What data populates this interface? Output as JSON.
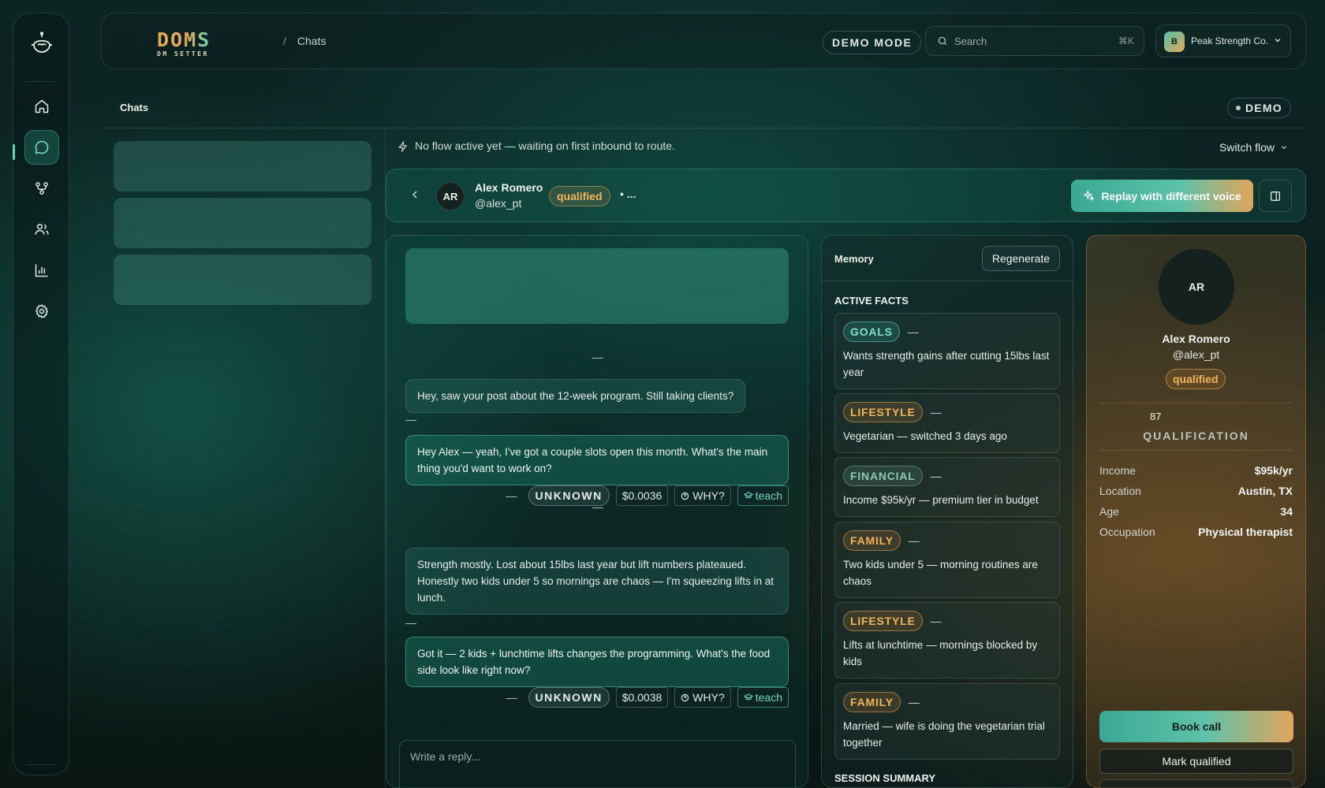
{
  "brand": {
    "name": "DOMS",
    "tagline": "DM SETTER"
  },
  "breadcrumb": {
    "separator": "/",
    "current": "Chats"
  },
  "header": {
    "demo_mode_label": "DEMO MODE",
    "search_placeholder": "Search",
    "search_shortcut": "⌘K",
    "org_initial": "B",
    "org_name": "Peak Strength Co."
  },
  "page": {
    "title": "Chats",
    "demo_badge": "DEMO"
  },
  "sidebar_nav": [
    {
      "icon": "home-icon"
    },
    {
      "icon": "chat-icon",
      "active": true
    },
    {
      "icon": "flow-icon"
    },
    {
      "icon": "users-icon"
    },
    {
      "icon": "analytics-icon"
    },
    {
      "icon": "settings-icon"
    }
  ],
  "flow_bar": {
    "status": "No flow active yet — waiting on first inbound to route.",
    "switch_label": "Switch flow"
  },
  "contact": {
    "initials": "AR",
    "name": "Alex Romero",
    "handle": "@alex_pt",
    "status": "qualified",
    "typing": "• ...",
    "replay_label": "Replay with different voice"
  },
  "conversation": {
    "messages": [
      {
        "dir": "in",
        "text": "Hey, saw your post about the 12-week program. Still taking clients?",
        "time": "—"
      },
      {
        "dir": "out",
        "text": "Hey Alex — yeah, I've got a couple slots open this month. What's the main thing you'd want to work on?",
        "time": "—",
        "voice": "UNKNOWN",
        "cost": "$0.0036",
        "why": "WHY?",
        "teach": "teach"
      },
      {
        "dir": "in",
        "text": "Strength mostly. Lost about 15lbs last year but lift numbers plateaued. Honestly two kids under 5 so mornings are chaos — I'm squeezing lifts in at lunch.",
        "time": "—"
      },
      {
        "dir": "out",
        "text": "Got it — 2 kids + lunchtime lifts changes the programming. What's the food side look like right now?",
        "time": "—",
        "voice": "UNKNOWN",
        "cost": "$0.0038",
        "why": "WHY?",
        "teach": "teach"
      }
    ],
    "day_separator": "—",
    "composer_placeholder": "Write a reply..."
  },
  "memory": {
    "title": "Memory",
    "regenerate_label": "Regenerate",
    "active_facts_title": "ACTIVE FACTS",
    "facts": [
      {
        "category": "GOALS",
        "dash": "—",
        "text": "Wants strength gains after cutting 15lbs last year"
      },
      {
        "category": "LIFESTYLE",
        "dash": "—",
        "text": "Vegetarian — switched 3 days ago"
      },
      {
        "category": "FINANCIAL",
        "dash": "—",
        "text": "Income $95k/yr — premium tier in budget"
      },
      {
        "category": "FAMILY",
        "dash": "—",
        "text": "Two kids under 5 — morning routines are chaos"
      },
      {
        "category": "LIFESTYLE",
        "dash": "—",
        "text": "Lifts at lunchtime — mornings blocked by kids"
      },
      {
        "category": "FAMILY",
        "dash": "—",
        "text": "Married — wife is doing the vegetarian trial together"
      }
    ],
    "session_summary_title": "SESSION SUMMARY"
  },
  "profile": {
    "initials": "AR",
    "name": "Alex Romero",
    "handle": "@alex_pt",
    "status": "qualified",
    "score": "87",
    "score_label": "QUALIFICATION",
    "details": [
      {
        "label": "Income",
        "value": "$95k/yr"
      },
      {
        "label": "Location",
        "value": "Austin, TX"
      },
      {
        "label": "Age",
        "value": "34"
      },
      {
        "label": "Occupation",
        "value": "Physical therapist"
      }
    ],
    "book_call_label": "Book call",
    "mark_qualified_label": "Mark qualified"
  },
  "colors": {
    "accent_teal": "#5fd6bf",
    "accent_amber": "#f0b45e",
    "background": "#0b1f1d"
  }
}
